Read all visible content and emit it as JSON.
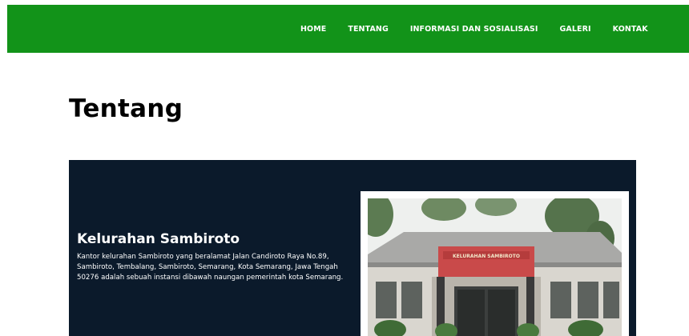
{
  "nav": {
    "items": [
      "HOME",
      "TENTANG",
      "INFORMASI DAN SOSIALISASI",
      "GALERI",
      "KONTAK"
    ],
    "bg_color": "#129319"
  },
  "page": {
    "title": "Tentang"
  },
  "hero": {
    "bg_color": "#0b1a2b",
    "title": "Kelurahan Sambiroto",
    "description": "Kantor kelurahan Sambiroto yang beralamat Jalan Candiroto Raya No.89, Sambiroto, Tembalang, Sambiroto, Semarang, Kota Semarang, Jawa Tengah 50276 adalah sebuah instansi dibawah naungan pemerintah kota Semarang.",
    "photo_sign": "KELURAHAN SAMBIROTO"
  }
}
